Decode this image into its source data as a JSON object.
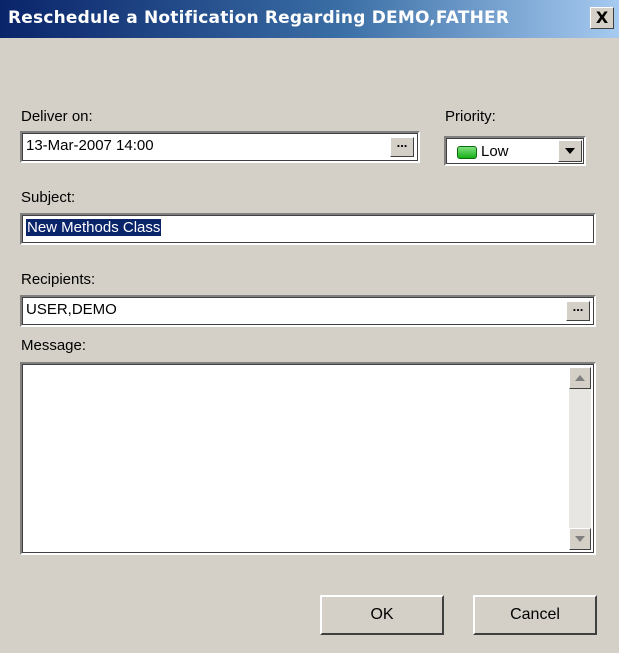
{
  "window": {
    "title": "Reschedule a Notification Regarding DEMO,FATHER",
    "close_label": "X"
  },
  "deliver": {
    "label": "Deliver on:",
    "value": "13-Mar-2007 14:00",
    "button_label": "..."
  },
  "priority": {
    "label": "Priority:",
    "value": "Low",
    "swatch_color": "#2dbf2d"
  },
  "subject": {
    "label": "Subject:",
    "value": "New Methods Class"
  },
  "recipients": {
    "label": "Recipients:",
    "value": "USER,DEMO",
    "button_label": "..."
  },
  "message": {
    "label": "Message:",
    "value": ""
  },
  "buttons": {
    "ok": "OK",
    "cancel": "Cancel"
  },
  "colors": {
    "titlebar_start": "#0a246a",
    "titlebar_end": "#a6caf0",
    "dialog_face": "#d4d0c8",
    "selection": "#0a246a"
  }
}
